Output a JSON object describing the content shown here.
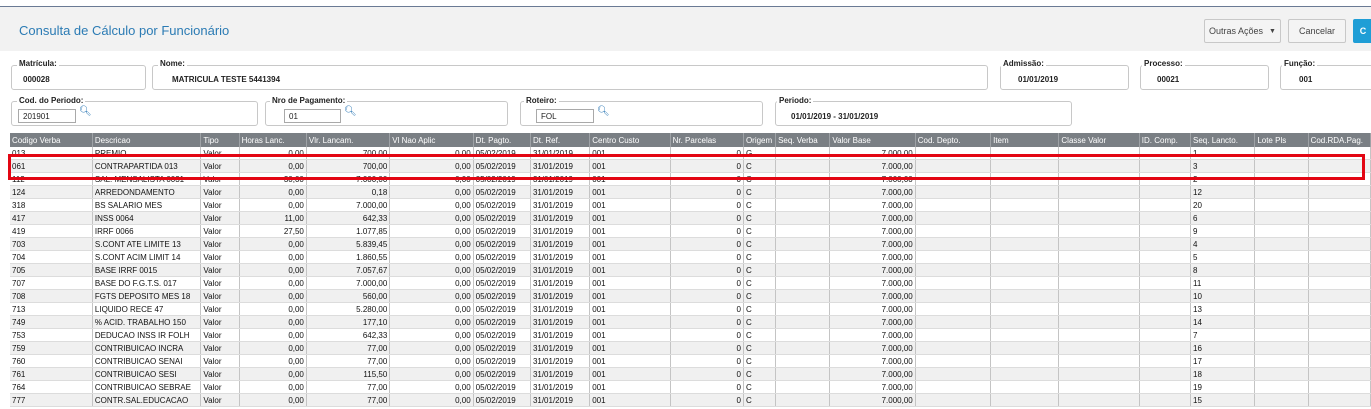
{
  "header": {
    "title": "Consulta de Cálculo por Funcionário"
  },
  "toolbar": {
    "other_actions": "Outras Ações",
    "cancel": "Cancelar",
    "confirm": "C"
  },
  "fields": {
    "matricula": {
      "label": "Matrícula:",
      "value": "000028"
    },
    "nome": {
      "label": "Nome:",
      "value": "MATRICULA TESTE 5441394"
    },
    "admissao": {
      "label": "Admissão:",
      "value": "01/01/2019"
    },
    "processo": {
      "label": "Processo:",
      "value": "00021"
    },
    "funcao": {
      "label": "Função:",
      "value": "001"
    },
    "cod_periodo": {
      "label": "Cod. do Periodo:",
      "value": "201901"
    },
    "nro_pagamento": {
      "label": "Nro de Pagamento:",
      "value": "01"
    },
    "roteiro": {
      "label": "Roteiro:",
      "value": "FOL"
    },
    "periodo": {
      "label": "Periodo:",
      "value": "01/01/2019 - 31/01/2019"
    }
  },
  "table": {
    "columns": [
      "Codigo Verba",
      "Descricao",
      "Tipo",
      "Horas Lanc.",
      "Vlr. Lancam.",
      "Vl Nao Aplic",
      "Dt. Pagto.",
      "Dt. Ref.",
      "Centro Custo",
      "Nr. Parcelas",
      "Origem",
      "Seq. Verba",
      "Valor Base",
      "Cod. Depto.",
      "Item",
      "Classe Valor",
      "ID. Comp.",
      "Seq. Lancto.",
      "Lote Pls",
      "Cod.RDA.Pag."
    ],
    "rows": [
      [
        "013",
        "PREMIO",
        "Valor",
        "0,00",
        "700,00",
        "0,00",
        "05/02/2019",
        "31/01/2019",
        "001",
        "0",
        "G",
        "",
        "7.000,00",
        "",
        "",
        "",
        "",
        "1",
        "",
        ""
      ],
      [
        "061",
        "CONTRAPARTIDA 013",
        "Valor",
        "0,00",
        "700,00",
        "0,00",
        "05/02/2019",
        "31/01/2019",
        "001",
        "0",
        "C",
        "",
        "7.000,00",
        "",
        "",
        "",
        "",
        "3",
        "",
        ""
      ],
      [
        "112",
        "SAL. MENSALISTA 0031",
        "Valor",
        "30,00",
        "7.000,00",
        "0,00",
        "05/02/2019",
        "31/01/2019",
        "001",
        "0",
        "C",
        "",
        "7.000,00",
        "",
        "",
        "",
        "",
        "2",
        "",
        ""
      ],
      [
        "124",
        "ARREDONDAMENTO",
        "Valor",
        "0,00",
        "0,18",
        "0,00",
        "05/02/2019",
        "31/01/2019",
        "001",
        "0",
        "C",
        "",
        "7.000,00",
        "",
        "",
        "",
        "",
        "12",
        "",
        ""
      ],
      [
        "318",
        "BS SALARIO MES",
        "Valor",
        "0,00",
        "7.000,00",
        "0,00",
        "05/02/2019",
        "31/01/2019",
        "001",
        "0",
        "C",
        "",
        "7.000,00",
        "",
        "",
        "",
        "",
        "20",
        "",
        ""
      ],
      [
        "417",
        "INSS 0064",
        "Valor",
        "11,00",
        "642,33",
        "0,00",
        "05/02/2019",
        "31/01/2019",
        "001",
        "0",
        "C",
        "",
        "7.000,00",
        "",
        "",
        "",
        "",
        "6",
        "",
        ""
      ],
      [
        "419",
        "IRRF 0066",
        "Valor",
        "27,50",
        "1.077,85",
        "0,00",
        "05/02/2019",
        "31/01/2019",
        "001",
        "0",
        "C",
        "",
        "7.000,00",
        "",
        "",
        "",
        "",
        "9",
        "",
        ""
      ],
      [
        "703",
        "S.CONT ATE LIMITE 13",
        "Valor",
        "0,00",
        "5.839,45",
        "0,00",
        "05/02/2019",
        "31/01/2019",
        "001",
        "0",
        "C",
        "",
        "7.000,00",
        "",
        "",
        "",
        "",
        "4",
        "",
        ""
      ],
      [
        "704",
        "S.CONT ACIM LIMIT 14",
        "Valor",
        "0,00",
        "1.860,55",
        "0,00",
        "05/02/2019",
        "31/01/2019",
        "001",
        "0",
        "C",
        "",
        "7.000,00",
        "",
        "",
        "",
        "",
        "5",
        "",
        ""
      ],
      [
        "705",
        "BASE IRRF 0015",
        "Valor",
        "0,00",
        "7.057,67",
        "0,00",
        "05/02/2019",
        "31/01/2019",
        "001",
        "0",
        "C",
        "",
        "7.000,00",
        "",
        "",
        "",
        "",
        "8",
        "",
        ""
      ],
      [
        "707",
        "BASE DO F.G.T.S. 017",
        "Valor",
        "0,00",
        "7.000,00",
        "0,00",
        "05/02/2019",
        "31/01/2019",
        "001",
        "0",
        "C",
        "",
        "7.000,00",
        "",
        "",
        "",
        "",
        "11",
        "",
        ""
      ],
      [
        "708",
        "FGTS DEPOSITO MES 18",
        "Valor",
        "0,00",
        "560,00",
        "0,00",
        "05/02/2019",
        "31/01/2019",
        "001",
        "0",
        "C",
        "",
        "7.000,00",
        "",
        "",
        "",
        "",
        "10",
        "",
        ""
      ],
      [
        "713",
        "LIQUIDO RECE 47",
        "Valor",
        "0,00",
        "5.280,00",
        "0,00",
        "05/02/2019",
        "31/01/2019",
        "001",
        "0",
        "C",
        "",
        "7.000,00",
        "",
        "",
        "",
        "",
        "13",
        "",
        ""
      ],
      [
        "749",
        "% ACID. TRABALHO 150",
        "Valor",
        "0,00",
        "177,10",
        "0,00",
        "05/02/2019",
        "31/01/2019",
        "001",
        "0",
        "C",
        "",
        "7.000,00",
        "",
        "",
        "",
        "",
        "14",
        "",
        ""
      ],
      [
        "753",
        "DEDUCAO INSS IR FOLH",
        "Valor",
        "0,00",
        "642,33",
        "0,00",
        "05/02/2019",
        "31/01/2019",
        "001",
        "0",
        "C",
        "",
        "7.000,00",
        "",
        "",
        "",
        "",
        "7",
        "",
        ""
      ],
      [
        "759",
        "CONTRIBUICAO INCRA",
        "Valor",
        "0,00",
        "77,00",
        "0,00",
        "05/02/2019",
        "31/01/2019",
        "001",
        "0",
        "C",
        "",
        "7.000,00",
        "",
        "",
        "",
        "",
        "16",
        "",
        ""
      ],
      [
        "760",
        "CONTRIBUICAO SENAI",
        "Valor",
        "0,00",
        "77,00",
        "0,00",
        "05/02/2019",
        "31/01/2019",
        "001",
        "0",
        "C",
        "",
        "7.000,00",
        "",
        "",
        "",
        "",
        "17",
        "",
        ""
      ],
      [
        "761",
        "CONTRIBUICAO SESI",
        "Valor",
        "0,00",
        "115,50",
        "0,00",
        "05/02/2019",
        "31/01/2019",
        "001",
        "0",
        "C",
        "",
        "7.000,00",
        "",
        "",
        "",
        "",
        "18",
        "",
        ""
      ],
      [
        "764",
        "CONTRIBUICAO SEBRAE",
        "Valor",
        "0,00",
        "77,00",
        "0,00",
        "05/02/2019",
        "31/01/2019",
        "001",
        "0",
        "C",
        "",
        "7.000,00",
        "",
        "",
        "",
        "",
        "19",
        "",
        ""
      ],
      [
        "777",
        "CONTR.SAL.EDUCACAO",
        "Valor",
        "0,00",
        "77,00",
        "0,00",
        "05/02/2019",
        "31/01/2019",
        "001",
        "0",
        "C",
        "",
        "7.000,00",
        "",
        "",
        "",
        "",
        "15",
        "",
        ""
      ]
    ]
  },
  "icons": {
    "search": "search-icon",
    "dropdown": "chevron-down-icon"
  },
  "colors": {
    "title": "#2b7bb4",
    "grid_header": "#7a7f84",
    "highlight": "#e30613",
    "primary_button": "#1f9ed6"
  }
}
